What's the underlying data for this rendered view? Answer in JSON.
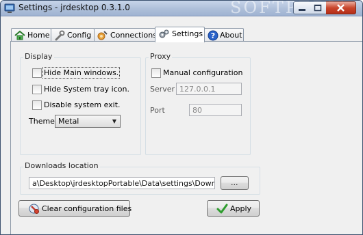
{
  "window": {
    "title": "Settings - jrdesktop 0.3.1.0",
    "watermark": "SOFTPEDIA"
  },
  "tabs": [
    {
      "label": "Home",
      "icon": "home-icon"
    },
    {
      "label": "Config",
      "icon": "wrench-icon"
    },
    {
      "label": "Connections",
      "icon": "connections-icon"
    },
    {
      "label": "Settings",
      "icon": "gears-icon",
      "active": true
    },
    {
      "label": "About",
      "icon": "help-icon"
    }
  ],
  "display": {
    "label": "Display",
    "options": [
      {
        "label": "Hide Main windows.",
        "checked": false
      },
      {
        "label": "Hide System tray icon.",
        "checked": false
      },
      {
        "label": "Disable system exit.",
        "checked": false
      }
    ],
    "theme_label": "Theme",
    "theme_value": "Metal"
  },
  "proxy": {
    "label": "Proxy",
    "manual_label": "Manual configuration",
    "manual_checked": false,
    "server_label": "Server",
    "server_value": "127.0.0.1",
    "port_label": "Port",
    "port_value": "80"
  },
  "downloads": {
    "label": "Downloads location",
    "path": "a\\Desktop\\jrdesktopPortable\\Data\\settings\\Downloads\\",
    "browse_label": "..."
  },
  "actions": {
    "clear_label": "Clear configuration files",
    "apply_label": "Apply"
  },
  "colors": {
    "titlebar": "#aebfd9",
    "close_button": "#c9462c",
    "apply_check": "#2f9d2f"
  }
}
